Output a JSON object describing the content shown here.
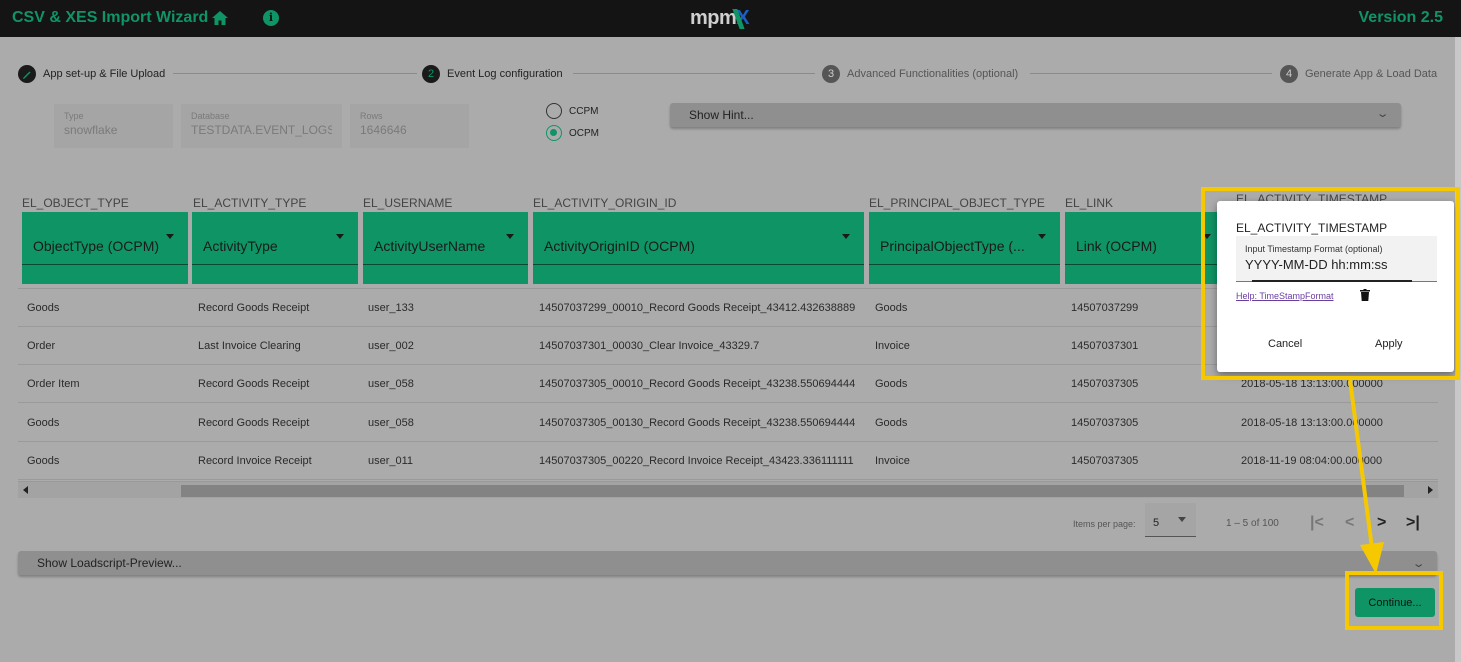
{
  "header": {
    "title": "CSV & XES Import Wizard",
    "logo_text": "mpm",
    "logo_accent": "X",
    "version": "Version 2.5",
    "icons": [
      "home-icon",
      "info-icon"
    ]
  },
  "stepper": [
    {
      "index": "",
      "icon": "pencil-icon",
      "label": "App set-up & File Upload",
      "state": "done"
    },
    {
      "index": "2",
      "label": "Event Log configuration",
      "state": "active"
    },
    {
      "index": "3",
      "label": "Advanced Functionalities (optional)",
      "state": "inactive"
    },
    {
      "index": "4",
      "label": "Generate App & Load Data",
      "state": "inactive"
    }
  ],
  "source_info": {
    "type": {
      "label": "Type",
      "value": "snowflake"
    },
    "database": {
      "label": "Database",
      "value": "TESTDATA.EVENT_LOGS."
    },
    "rows": {
      "label": "Rows",
      "value": "1646646"
    }
  },
  "mode": {
    "options": [
      "CCPM",
      "OCPM"
    ],
    "selected": "OCPM"
  },
  "hint_panel": {
    "label": "Show Hint..."
  },
  "table": {
    "columns": [
      {
        "source": "EL_OBJECT_TYPE",
        "mapping": "ObjectType (OCPM)"
      },
      {
        "source": "EL_ACTIVITY_TYPE",
        "mapping": "ActivityType"
      },
      {
        "source": "EL_USERNAME",
        "mapping": "ActivityUserName"
      },
      {
        "source": "EL_ACTIVITY_ORIGIN_ID",
        "mapping": "ActivityOriginID (OCPM)"
      },
      {
        "source": "EL_PRINCIPAL_OBJECT_TYPE",
        "mapping": "PrincipalObjectType (..."
      },
      {
        "source": "EL_LINK",
        "mapping": "Link (OCPM)"
      },
      {
        "source": "EL_ACTIVITY_TIMESTAMP",
        "mapping": ""
      }
    ],
    "rows": [
      [
        "Goods",
        "Record Goods Receipt",
        "user_133",
        "14507037299_00010_Record Goods Receipt_43412.432638889",
        "Goods",
        "14507037299",
        ""
      ],
      [
        "Order",
        "Last Invoice Clearing",
        "user_002",
        "14507037301_00030_Clear Invoice_43329.7",
        "Invoice",
        "14507037301",
        ""
      ],
      [
        "Order Item",
        "Record Goods Receipt",
        "user_058",
        "14507037305_00010_Record Goods Receipt_43238.550694444",
        "Goods",
        "14507037305",
        "2018-05-18 13:13:00.000000"
      ],
      [
        "Goods",
        "Record Goods Receipt",
        "user_058",
        "14507037305_00130_Record Goods Receipt_43238.550694444",
        "Goods",
        "14507037305",
        "2018-05-18 13:13:00.000000"
      ],
      [
        "Goods",
        "Record Invoice Receipt",
        "user_011",
        "14507037305_00220_Record Invoice Receipt_43423.336111111",
        "Invoice",
        "14507037305",
        "2018-11-19 08:04:00.000000"
      ]
    ]
  },
  "paginator": {
    "items_per_page_label": "Items per page:",
    "items_per_page": "5",
    "range": "1 – 5 of 100",
    "buttons": {
      "first": "|<",
      "prev": "<",
      "next": ">",
      "last": ">|"
    }
  },
  "loadscript_panel": {
    "label": "Show Loadscript-Preview..."
  },
  "continue_button": {
    "label": "Continue..."
  },
  "timestamp_popup": {
    "title": "EL_ACTIVITY_TIMESTAMP",
    "field_label": "Input Timestamp Format (optional)",
    "field_value": "YYYY-MM-DD hh:mm:ss",
    "help_link": "Help: TimeStampFormat",
    "cancel_label": "Cancel",
    "apply_label": "Apply"
  },
  "colors": {
    "accent": "#0f9466",
    "topbar": "#141414",
    "highlight": "#f5c800",
    "logo_blue": "#1a5fc4"
  }
}
